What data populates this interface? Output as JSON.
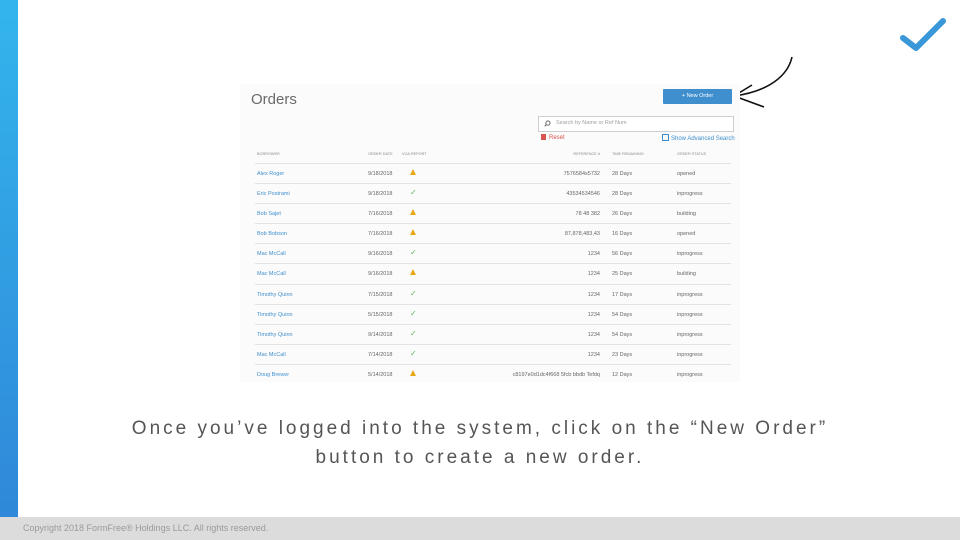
{
  "screen": {
    "title": "Orders",
    "new_order_button": "+ New Order",
    "search_placeholder": "Search by Name or Ref Num",
    "reset_label": "Reset",
    "advanced_search_label": "Show Advanced Search",
    "columns": [
      "BORROWER",
      "ORDER DATE",
      "VOA REPORT",
      "REFERENCE #",
      "TIME REMAINING",
      "ORDER STATUS"
    ],
    "rows": [
      {
        "borrower": "Alex Roger",
        "date": "9/18/2018",
        "report": "warning-icon",
        "ref": "7576584s5732",
        "time": "28 Days",
        "status": "opened"
      },
      {
        "borrower": "Eric Postrami",
        "date": "9/18/2018",
        "report": "check-icon",
        "ref": "43534534546",
        "time": "28 Days",
        "status": "inprogress"
      },
      {
        "borrower": "Bob Sajet",
        "date": "7/16/2018",
        "report": "warning-icon",
        "ref": "78 48 382",
        "time": "26 Days",
        "status": "building"
      },
      {
        "borrower": "Bob Bobson",
        "date": "7/16/2018",
        "report": "warning-icon",
        "ref": "87,878,483,43",
        "time": "16 Days",
        "status": "opened"
      },
      {
        "borrower": "Mac McCall",
        "date": "9/16/2018",
        "report": "check-icon",
        "ref": "1234",
        "time": "56 Days",
        "status": "inprogress"
      },
      {
        "borrower": "Mac McCall",
        "date": "9/16/2018",
        "report": "warning-icon",
        "ref": "1234",
        "time": "25 Days",
        "status": "building"
      },
      {
        "borrower": "Timothy Quinn",
        "date": "7/15/2018",
        "report": "check-icon",
        "ref": "1234",
        "time": "17 Days",
        "status": "inprogress"
      },
      {
        "borrower": "Timothy Quinn",
        "date": "5/15/2018",
        "report": "check-icon",
        "ref": "1234",
        "time": "54 Days",
        "status": "inprogress"
      },
      {
        "borrower": "Timothy Quinn",
        "date": "9/14/2018",
        "report": "check-icon",
        "ref": "1234",
        "time": "54 Days",
        "status": "inprogress"
      },
      {
        "borrower": "Mac McCall",
        "date": "7/14/2018",
        "report": "check-icon",
        "ref": "1234",
        "time": "23 Days",
        "status": "inprogress"
      },
      {
        "borrower": "Doug Brewer",
        "date": "5/14/2018",
        "report": "warning-icon",
        "ref": "c8197e0d1dc4f668 5fcb bbdb Tefdq",
        "time": "12 Days",
        "status": "inprogress"
      }
    ]
  },
  "caption_line1": "Once you’ve logged into the system, click on the “New Order”",
  "caption_line2": "button to create a new order.",
  "footer": "Copyright 2018 FormFree® Holdings LLC. All rights reserved.",
  "colors": {
    "accent": "#3f8fce",
    "brand_bar": "#2f9be0",
    "warning": "#e6a817",
    "check": "#5cb85c"
  }
}
